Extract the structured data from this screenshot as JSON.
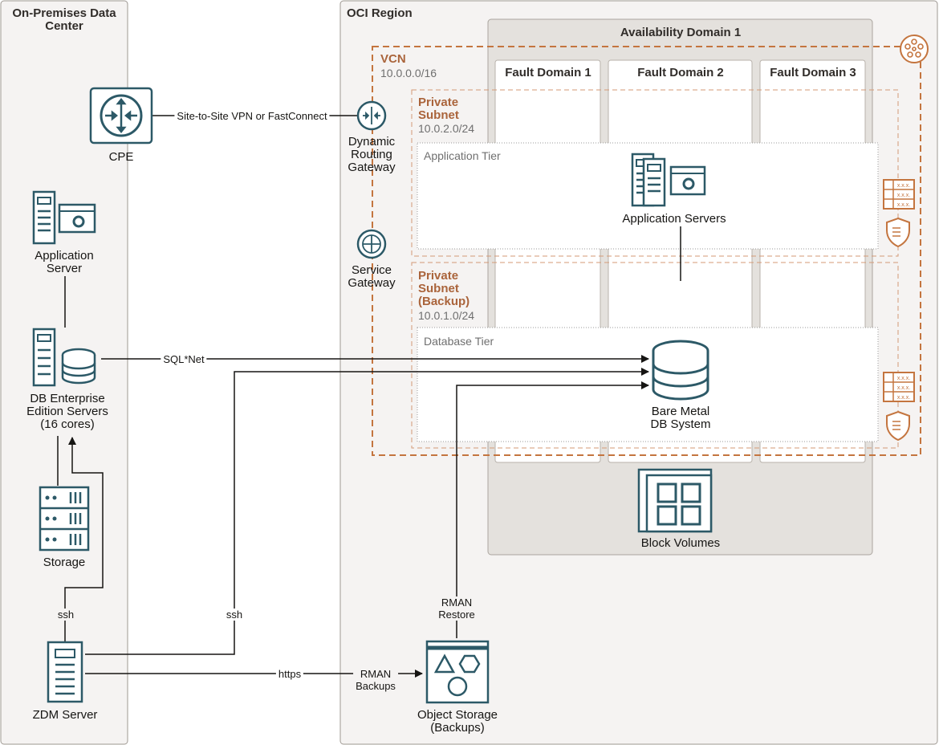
{
  "regions": {
    "on_prem_title": "On-Premises Data\nCenter",
    "oci_title": "OCI Region",
    "availability_domain": "Availability Domain 1",
    "fault_domains": [
      "Fault Domain 1",
      "Fault Domain 2",
      "Fault Domain 3"
    ]
  },
  "vcn": {
    "title": "VCN",
    "cidr": "10.0.0.0/16"
  },
  "subnets": [
    {
      "title": "Private\nSubnet",
      "cidr": "10.0.2.0/24",
      "tier": "Application Tier"
    },
    {
      "title": "Private\nSubnet\n(Backup)",
      "cidr": "10.0.1.0/24",
      "tier": "Database Tier"
    }
  ],
  "nodes": {
    "cpe": "CPE",
    "drg": "Dynamic\nRouting\nGateway",
    "service_gateway": "Service\nGateway",
    "app_server_onprem": "Application\nServer",
    "db_ee_servers": "DB Enterprise\nEdition Servers\n(16 cores)",
    "storage": "Storage",
    "zdm_server": "ZDM Server",
    "app_servers_oci": "Application Servers",
    "bare_metal_db": "Bare Metal\nDB System",
    "block_volumes": "Block Volumes",
    "object_storage": "Object Storage\n(Backups)"
  },
  "connections": {
    "vpn": "Site-to-Site VPN or FastConnect",
    "sqlnet": "SQL*Net",
    "ssh_onprem": "ssh",
    "ssh_oci": "ssh",
    "https": "https",
    "rman_backups": "RMAN\nBackups",
    "rman_restore": "RMAN\nRestore"
  },
  "colors": {
    "region_bg": "#f5f3f2",
    "region_border": "#9e9892",
    "ad_bg": "#e4e1dd",
    "vcn_orange": "#c4753f",
    "icon_teal": "#2c5967",
    "line": "#161513"
  }
}
